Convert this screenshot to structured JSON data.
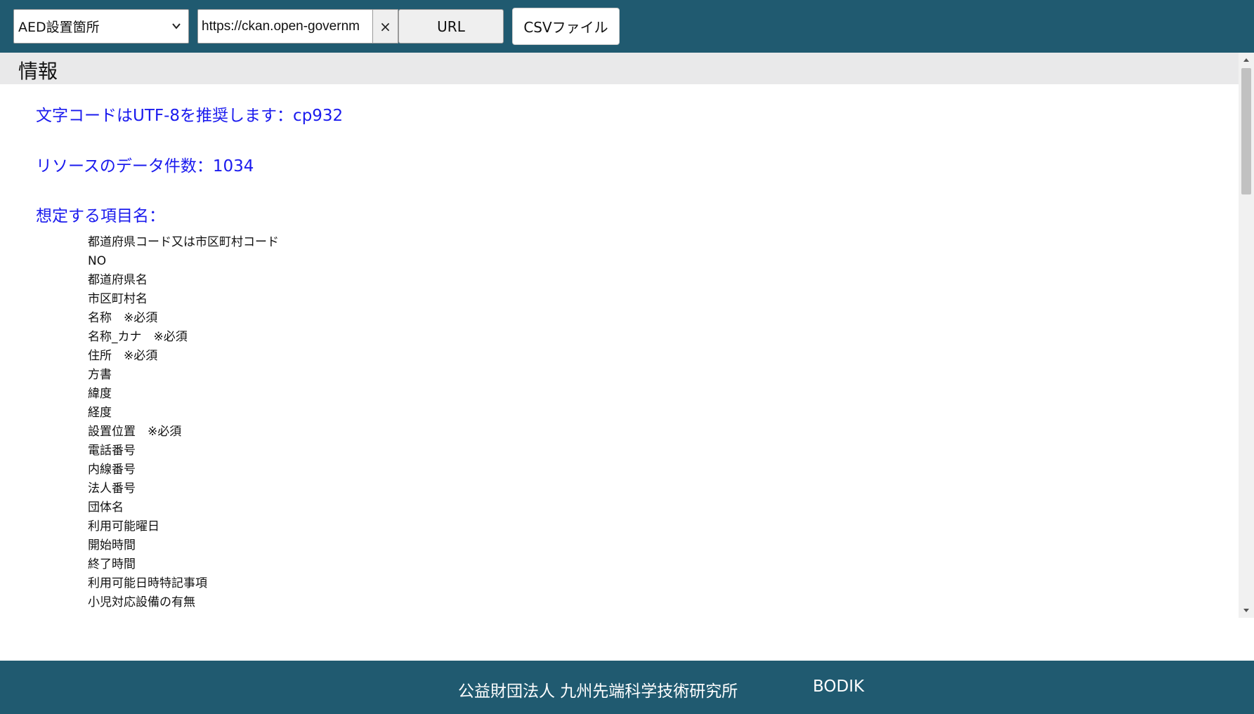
{
  "toolbar": {
    "dataset_select": {
      "selected": "AED設置箇所",
      "icon": "chevron-down-icon"
    },
    "url_input": {
      "value": "https://ckan.open-governm"
    },
    "clear_label": "×",
    "url_button_label": "URL",
    "csv_button_label": "CSVファイル"
  },
  "info": {
    "title": "情報",
    "encoding_line": "文字コードはUTF-8を推奨します：cp932",
    "count_line": "リソースのデータ件数：1034",
    "fields_heading": "想定する項目名：",
    "fields": [
      "都道府県コード又は市区町村コード",
      "NO",
      "都道府県名",
      "市区町村名",
      "名称　※必須",
      "名称_カナ　※必須",
      "住所　※必須",
      "方書",
      "緯度",
      "経度",
      "設置位置　※必須",
      "電話番号",
      "内線番号",
      "法人番号",
      "団体名",
      "利用可能曜日",
      "開始時間",
      "終了時間",
      "利用可能日時特記事項",
      "小児対応設備の有無"
    ]
  },
  "footer": {
    "org": "公益財団法人 九州先端科学技術研究所",
    "bodik": "BODIK"
  },
  "colors": {
    "header_bg": "#205a70",
    "footer_bg": "#205a70",
    "info_text": "#1a1aee",
    "section_header_bg": "#e9e9ea"
  }
}
